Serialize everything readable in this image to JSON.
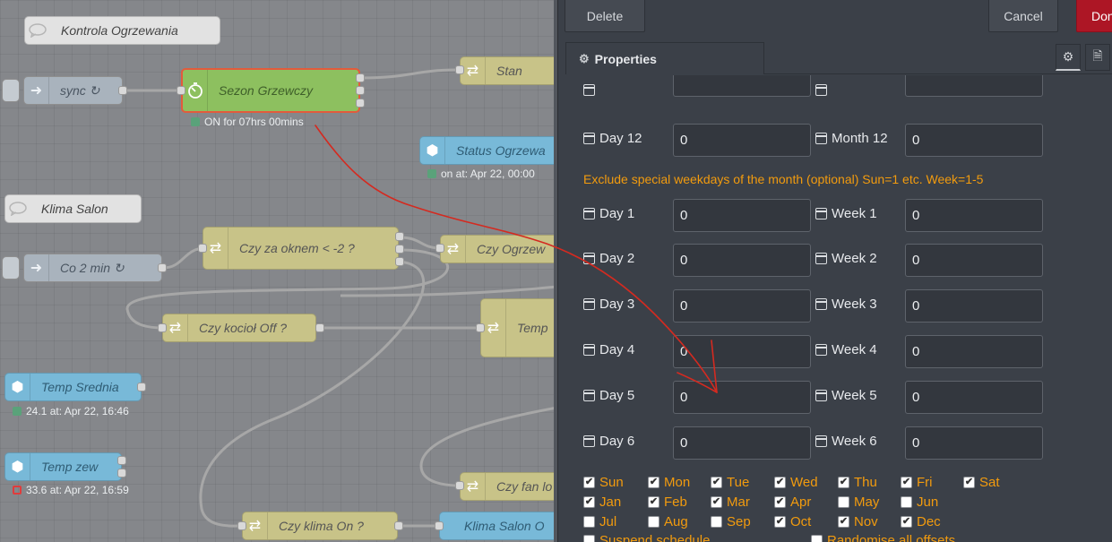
{
  "flow": {
    "comment_ogrzewanie": "Kontrola Ogrzewania",
    "inject_sync": "sync ↻",
    "timer_sezon": "Sezon Grzewczy",
    "timer_status": "ON for 07hrs 00mins",
    "switch_stan": "Stan",
    "status_ogrzewa": "Status Ogrzewa",
    "status_ogrzewa_text": "on at: Apr 22, 00:00",
    "comment_klima": "Klima Salon",
    "inject_co2": "Co 2 min ↻",
    "switch_czy_za_oknem": "Czy za oknem < -2 ?",
    "switch_czy_ogrzew": "Czy Ogrzew",
    "switch_czy_kociol": "Czy kocioł Off ?",
    "switch_temp": "Temp",
    "status_temp_srednia": "Temp Srednia",
    "status_temp_srednia_text": "24.1 at: Apr 22, 16:46",
    "status_temp_zew": "Temp zew",
    "status_temp_zew_text": "33.6 at: Apr 22, 16:59",
    "switch_czy_fan": "Czy fan lo",
    "switch_czy_klima": "Czy klima On ?",
    "status_klima_salon": "Klima Salon O"
  },
  "tray": {
    "delete": "Delete",
    "cancel": "Cancel",
    "done": "Done",
    "tab_properties": "Properties",
    "info_text": "Exclude special weekdays of the month (optional) Sun=1 etc. Week=1-5",
    "day12_label": "Day 12",
    "day12_value": "0",
    "month12_label": "Month 12",
    "month12_value": "0",
    "rows": [
      {
        "day": "Day 1",
        "day_val": "0",
        "week": "Week 1",
        "week_val": "0"
      },
      {
        "day": "Day 2",
        "day_val": "0",
        "week": "Week 2",
        "week_val": "0"
      },
      {
        "day": "Day 3",
        "day_val": "0",
        "week": "Week 3",
        "week_val": "0"
      },
      {
        "day": "Day 4",
        "day_val": "0",
        "week": "Week 4",
        "week_val": "0"
      },
      {
        "day": "Day 5",
        "day_val": "0",
        "week": "Week 5",
        "week_val": "0"
      },
      {
        "day": "Day 6",
        "day_val": "0",
        "week": "Week 6",
        "week_val": "0"
      }
    ],
    "weekdays": [
      {
        "label": "Sun",
        "checked": true
      },
      {
        "label": "Mon",
        "checked": true
      },
      {
        "label": "Tue",
        "checked": true
      },
      {
        "label": "Wed",
        "checked": true
      },
      {
        "label": "Thu",
        "checked": true
      },
      {
        "label": "Fri",
        "checked": true
      },
      {
        "label": "Sat",
        "checked": true
      }
    ],
    "months_row1": [
      {
        "label": "Jan",
        "checked": true
      },
      {
        "label": "Feb",
        "checked": true
      },
      {
        "label": "Mar",
        "checked": true
      },
      {
        "label": "Apr",
        "checked": true
      },
      {
        "label": "May",
        "checked": false
      },
      {
        "label": "Jun",
        "checked": false
      }
    ],
    "months_row2": [
      {
        "label": "Jul",
        "checked": false
      },
      {
        "label": "Aug",
        "checked": false
      },
      {
        "label": "Sep",
        "checked": false
      },
      {
        "label": "Oct",
        "checked": true
      },
      {
        "label": "Nov",
        "checked": true
      },
      {
        "label": "Dec",
        "checked": true
      }
    ],
    "suspend_label": "Suspend schedule",
    "randomise_label": "Randomise all offsets"
  },
  "colors": {
    "accent_orange": "#f29b0e",
    "done_red": "#ad1625",
    "annotation_red": "#d42a20"
  }
}
